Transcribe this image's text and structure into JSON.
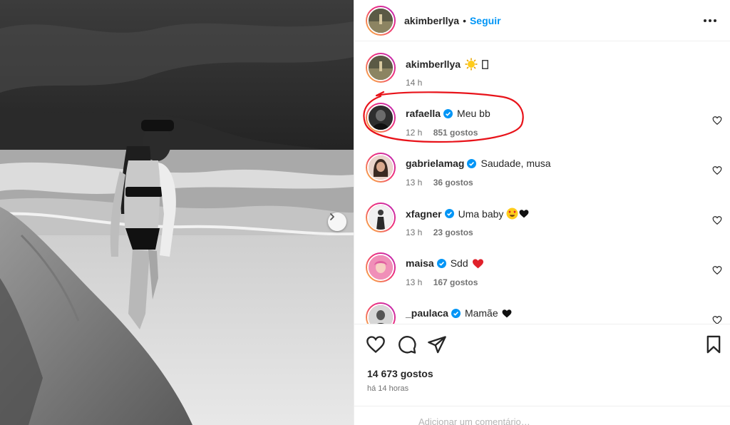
{
  "post": {
    "author": "akimberllya",
    "follow_label": "Seguir",
    "separator": "•",
    "caption": {
      "username": "akimberllya",
      "time": "14 h",
      "emoji_icons": [
        "sun-emoji-icon",
        "unknown-glyph-icon"
      ]
    },
    "likes": "14 673 gostos",
    "posted_ago": "há 14 horas",
    "add_comment_placeholder": "Adicionar um comentário…"
  },
  "comments": [
    {
      "username": "rafaella",
      "verified": true,
      "text": "Meu bb",
      "time": "12 h",
      "likes": "851 gostos",
      "highlighted": true
    },
    {
      "username": "gabrielamag",
      "verified": true,
      "text": "Saudade, musa",
      "time": "13 h",
      "likes": "36 gostos"
    },
    {
      "username": "xfagner",
      "verified": true,
      "text": "Uma baby",
      "emoji_icons": [
        "heart-eyes-emoji-icon",
        "black-heart-icon"
      ],
      "time": "13 h",
      "likes": "23 gostos"
    },
    {
      "username": "maisa",
      "verified": true,
      "text": "Sdd",
      "emoji_icons": [
        "red-heart-icon"
      ],
      "time": "13 h",
      "likes": "167 gostos"
    },
    {
      "username": "_paulaca",
      "verified": true,
      "text": "Mamãe",
      "emoji_icons": [
        "black-heart-icon"
      ]
    }
  ],
  "colors": {
    "accent_blue": "#0095f6",
    "annotation_red": "#e8131a",
    "muted_text": "#737373"
  }
}
